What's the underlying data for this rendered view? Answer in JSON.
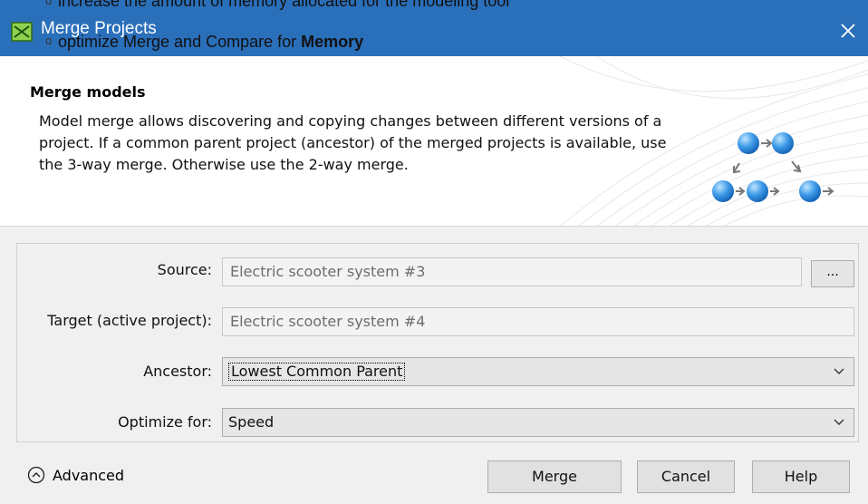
{
  "window": {
    "title": "Merge Projects",
    "overlay_line_1": "increase the amount of memory allocated for the modeling tool",
    "overlay_line_2_prefix": "optimize Merge and Compare for ",
    "overlay_line_2_bold": "Memory",
    "bullet_glyph": "o"
  },
  "header": {
    "title": "Merge models",
    "description": "Model merge allows discovering and copying changes between different versions of a project. If a common parent project (ancestor) of the merged projects is available, use the 3-way merge. Otherwise use the 2-way merge."
  },
  "form": {
    "source_label": "Source:",
    "source_value": "Electric scooter system #3",
    "browse_label": "...",
    "target_label": "Target (active project):",
    "target_value": "Electric scooter system #4",
    "ancestor_label": "Ancestor:",
    "ancestor_value": "Lowest Common Parent",
    "optimize_label": "Optimize for:",
    "optimize_value": "Speed"
  },
  "footer": {
    "advanced_label": "Advanced",
    "merge_label": "Merge",
    "cancel_label": "Cancel",
    "help_label": "Help"
  },
  "icons": {
    "app": "merge-app-icon",
    "close": "close-icon",
    "advanced_toggle": "chevron-up-circle-icon",
    "dropdown": "chevron-down-icon"
  },
  "colors": {
    "titlebar": "#2a6fba",
    "accent_blue": "#3d8fe0"
  }
}
